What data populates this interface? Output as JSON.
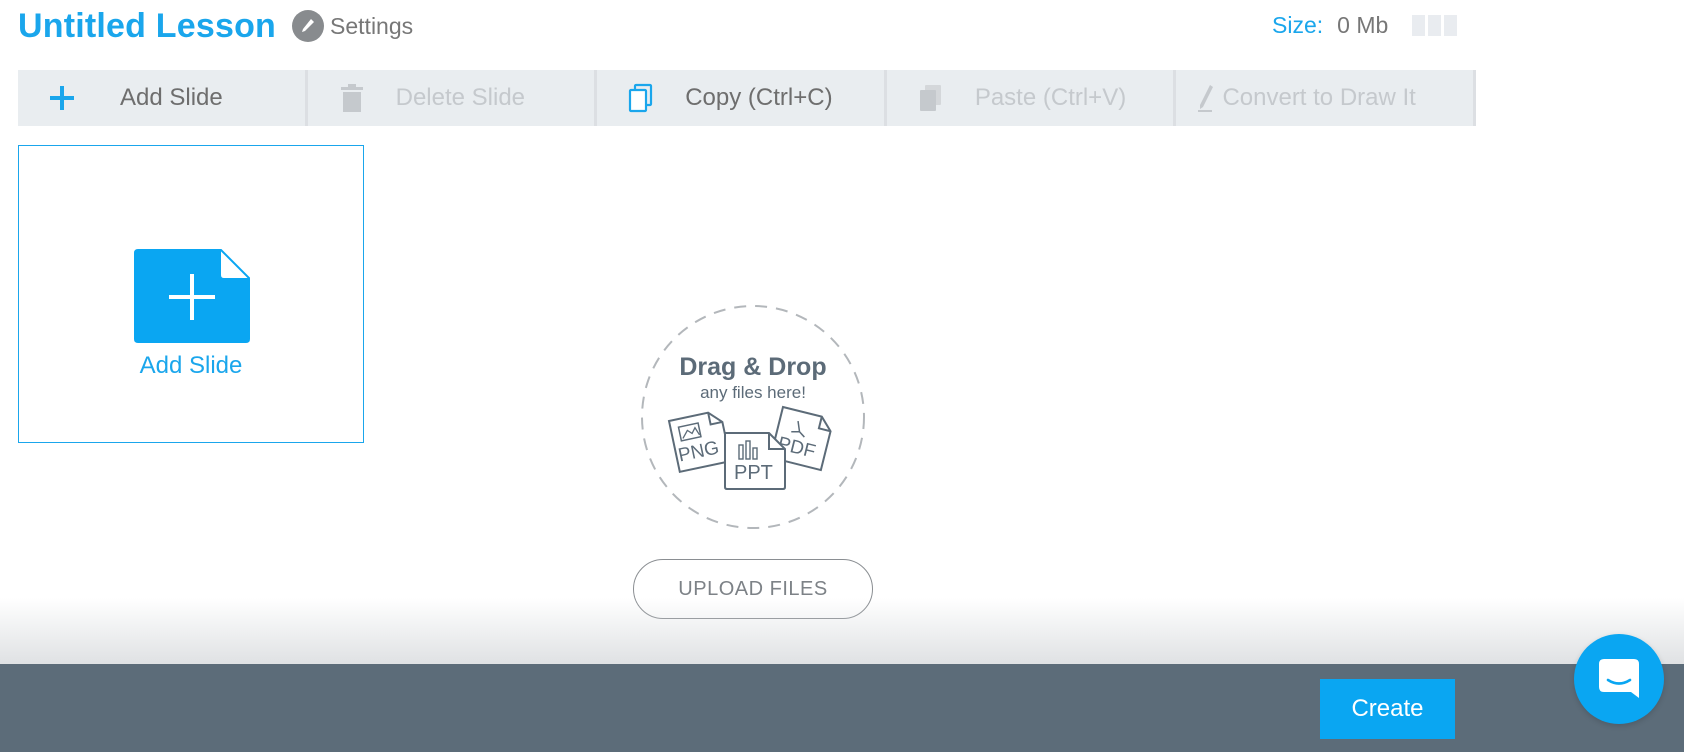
{
  "header": {
    "title": "Untitled Lesson",
    "settings_label": "Settings",
    "size_label": "Size:",
    "size_value": "0 Mb"
  },
  "toolbar": {
    "add_slide": "Add Slide",
    "delete_slide": "Delete Slide",
    "copy": "Copy (Ctrl+C)",
    "paste": "Paste (Ctrl+V)",
    "convert": "Convert to Draw It"
  },
  "slide_card": {
    "label": "Add Slide"
  },
  "dropzone": {
    "title": "Drag & Drop",
    "subtitle": "any files here!",
    "file_types": [
      "PNG",
      "PPT",
      "PDF"
    ]
  },
  "upload_button": "UPLOAD FILES",
  "footer": {
    "create_button": "Create"
  },
  "colors": {
    "accent": "#1aa6ec",
    "footer_bg": "#5c6c79",
    "toolbar_bg": "#e9edf0",
    "disabled_text": "#c5c9cd"
  }
}
